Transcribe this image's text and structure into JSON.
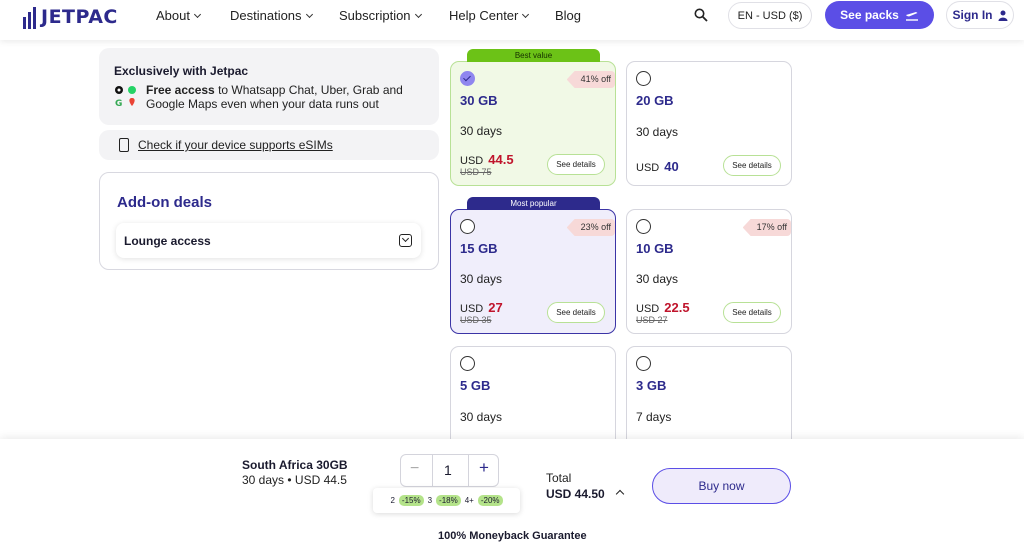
{
  "nav": {
    "logo": "JETPAC",
    "items": [
      "About",
      "Destinations",
      "Subscription",
      "Help Center",
      "Blog"
    ],
    "language": "EN - USD ($)",
    "see_packs": "See packs",
    "sign_in": "Sign In"
  },
  "exclusive": {
    "title": "Exclusively with Jetpac",
    "bold": "Free access",
    "text": " to Whatsapp Chat, Uber, Grab and Google Maps even when your data runs out"
  },
  "check_link": "Check if your device supports eSIMs",
  "addon": {
    "title": "Add-on deals",
    "lounge": "Lounge access"
  },
  "cards": [
    {
      "ribbon": "Best value",
      "gb": "30 GB",
      "days": "30 days",
      "currency": "USD",
      "price": "44.5",
      "old": "USD 75",
      "off": "41% off",
      "details": "See details",
      "selected": true
    },
    {
      "ribbon": "",
      "gb": "20 GB",
      "days": "30 days",
      "currency": "USD",
      "price": "40",
      "old": "",
      "off": "",
      "details": "See details",
      "selected": false
    },
    {
      "ribbon": "Most popular",
      "gb": "15 GB",
      "days": "30 days",
      "currency": "USD",
      "price": "27",
      "old": "USD 35",
      "off": "23% off",
      "details": "See details",
      "selected": false
    },
    {
      "ribbon": "",
      "gb": "10 GB",
      "days": "30 days",
      "currency": "USD",
      "price": "22.5",
      "old": "USD 27",
      "off": "17% off",
      "details": "See details",
      "selected": false
    },
    {
      "ribbon": "",
      "gb": "5 GB",
      "days": "30 days",
      "currency": "",
      "price": "",
      "old": "",
      "off": "",
      "details": "",
      "selected": false
    },
    {
      "ribbon": "",
      "gb": "3 GB",
      "days": "7 days",
      "currency": "",
      "price": "",
      "old": "",
      "off": "",
      "details": "",
      "selected": false
    }
  ],
  "bottom": {
    "product": "South Africa 30GB",
    "sub": "30 days  •  USD 44.5",
    "quantity": "1",
    "minus": "−",
    "plus": "+",
    "discounts": [
      {
        "qty": "2",
        "tag": "-15%"
      },
      {
        "qty": "3",
        "tag": "-18%"
      },
      {
        "qty": "4+",
        "tag": "-20%"
      }
    ],
    "total_label": "Total",
    "total_value": "USD 44.50",
    "buy": "Buy now",
    "guarantee": "100% Moneyback Guarantee"
  }
}
